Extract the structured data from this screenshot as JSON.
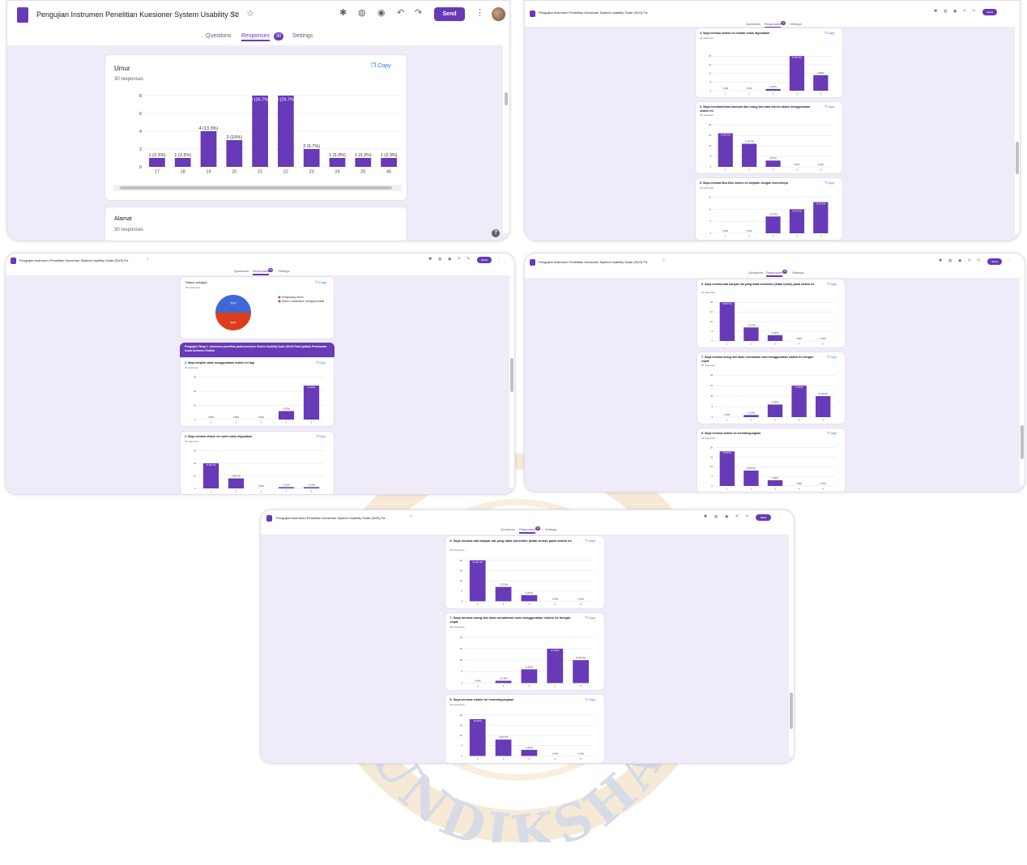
{
  "app": {
    "title": "Pengujian Instrumen Penelitian Kuesioner System Usability Sc",
    "title_small": "Pengujian Instrumen Penelitian Kuesioner System Usability Scale (SUS) Pa",
    "tabs": {
      "questions": "Questions",
      "responses": "Responses",
      "settings": "Settings"
    },
    "responses_count": "30",
    "send": "Send",
    "copy": "Copy",
    "help": "?"
  },
  "colors": {
    "accent": "#673ab7",
    "bg": "#f0ebf8",
    "blue": "#1a73e8",
    "pie_blue": "#4069d4",
    "pie_red": "#db3e1c"
  },
  "icons": [
    "forms-logo-icon",
    "folder-icon",
    "star-icon",
    "addon-icon",
    "palette-icon",
    "preview-eye-icon",
    "undo-icon",
    "redo-icon",
    "more-vert-icon",
    "copy-icon",
    "help-icon"
  ],
  "watermark": {
    "text": "UNDIKSHA"
  },
  "panel1": {
    "card_umur": {
      "title": "Umur",
      "responses": "30 responses",
      "chart_data": {
        "type": "bar",
        "categories": [
          "17",
          "18",
          "19",
          "20",
          "21",
          "22",
          "23",
          "24",
          "25",
          "45"
        ],
        "values": [
          1,
          1,
          4,
          3,
          8,
          8,
          2,
          1,
          1,
          1
        ],
        "labels": [
          "1 (3.3%)",
          "1 (3.3%)",
          "4 (13.3%)",
          "3 (10%)",
          "8 (26.7%)",
          "8 (26.7%)",
          "2 (6.7%)",
          "1 (3.3%)",
          "1 (3.3%)",
          "1 (3.3%)"
        ],
        "yticks": [
          "0",
          "2",
          "4",
          "6",
          "8"
        ],
        "ylim": [
          0,
          8
        ]
      }
    },
    "card_alamat": {
      "title": "Alamat",
      "responses": "30 responses"
    }
  },
  "panel2": {
    "cards": [
      {
        "title": "3. Saya merasa sistem ini mudah untuk digunakan",
        "responses": "30 responses",
        "chart_data": {
          "type": "bar",
          "categories": [
            "1",
            "2",
            "3",
            "4",
            "5"
          ],
          "values": [
            0,
            0,
            1,
            20,
            9
          ],
          "labels": [
            "0 (0%)",
            "0 (0%)",
            "1 (3.3%)",
            "20 (66.7%)",
            "9 (30%)"
          ],
          "yticks": [
            "0",
            "5",
            "10",
            "15",
            "20"
          ],
          "ylim": [
            0,
            25
          ]
        }
      },
      {
        "title": "4. Saya membutuhkan bantuan dari orang lain atau teknisi dalam menggunakan sistem ini",
        "responses": "30 responses",
        "chart_data": {
          "type": "bar",
          "categories": [
            "1",
            "2",
            "3",
            "4",
            "5"
          ],
          "values": [
            16,
            11,
            3,
            0,
            0
          ],
          "labels": [
            "16 (53.3%)",
            "11 (36.7%)",
            "3 (10%)",
            "0 (0%)",
            "0 (0%)"
          ],
          "yticks": [
            "0",
            "5",
            "10",
            "15",
            "20"
          ],
          "ylim": [
            0,
            20
          ]
        }
      },
      {
        "title": "5. Saya merasa fitur-fitur sistem ini berjalan dengan semestinya",
        "responses": "30 responses",
        "chart_data": {
          "type": "bar",
          "categories": [
            "1",
            "2",
            "3",
            "4",
            "5"
          ],
          "values": [
            0,
            0,
            7,
            10,
            13
          ],
          "labels": [
            "0 (0%)",
            "0 (0%)",
            "7 (23.3%)",
            "10 (33.3%)",
            "13 (43.3%)"
          ],
          "yticks": [
            "0",
            "5",
            "10",
            "15"
          ],
          "ylim": [
            0,
            15
          ]
        }
      }
    ]
  },
  "panel3": {
    "pie_card": {
      "title": "Status sebagai",
      "responses": "30 responses",
      "chart_data": {
        "type": "pie",
        "labels": [
          "Pengunjung umum",
          "Siswa / mahasiswa / tenaga pendidik"
        ],
        "values": [
          50,
          50
        ],
        "slice_labels": [
          "50%",
          "50%"
        ]
      }
    },
    "section": {
      "title": "Pengujian Tahap 1. Instrumen penelitian pada kuesioner Sistem Usability Scale (SUS) Pada Aplikasi Pemesanan Acara berbasis Chatbot"
    },
    "cards": [
      {
        "title": "1. Saya berpikir akan menggunakan sistem ini lagi",
        "responses": "30 responses",
        "chart_data": {
          "type": "bar",
          "categories": [
            "1",
            "2",
            "3",
            "4",
            "5"
          ],
          "values": [
            0,
            0,
            0,
            6,
            24
          ],
          "labels": [
            "0 (0%)",
            "0 (0%)",
            "0 (0%)",
            "6 (20%)",
            "24 (80%)"
          ],
          "yticks": [
            "0",
            "10",
            "20",
            "30"
          ],
          "ylim": [
            0,
            30
          ]
        }
      },
      {
        "title": "2. Saya merasa sistem ini rumit untuk digunakan",
        "responses": "30 responses",
        "chart_data": {
          "type": "bar",
          "categories": [
            "1",
            "2",
            "3",
            "4",
            "5"
          ],
          "values": [
            20,
            8,
            0,
            1,
            1
          ],
          "labels": [
            "20 (66.7%)",
            "8 (26.7%)",
            "0 (0%)",
            "1 (3.3%)",
            "1 (3.3%)"
          ],
          "yticks": [
            "0",
            "10",
            "20",
            "30"
          ],
          "ylim": [
            0,
            30
          ]
        }
      }
    ]
  },
  "panel4": {
    "cards": [
      {
        "title": "6. Saya merasa ada banyak hal yang tidak konsisten (tidak serasi) pada sistem ini",
        "responses": "30 responses",
        "chart_data": {
          "type": "bar",
          "categories": [
            "1",
            "2",
            "3",
            "4",
            "5"
          ],
          "values": [
            20,
            7,
            3,
            0,
            0
          ],
          "labels": [
            "20 (66.7%)",
            "7 (23.3%)",
            "3 (10%)",
            "0 (0%)",
            "0 (0%)"
          ],
          "yticks": [
            "0",
            "5",
            "10",
            "15",
            "20"
          ],
          "ylim": [
            0,
            20
          ]
        }
      },
      {
        "title": "7. Saya merasa orang lain akan memahami cara menggunakan sistem ini dengan cepat",
        "responses": "30 responses",
        "chart_data": {
          "type": "bar",
          "categories": [
            "1",
            "2",
            "3",
            "4",
            "5"
          ],
          "values": [
            0,
            1,
            6,
            15,
            10
          ],
          "labels": [
            "0 (0%)",
            "1 (3.3%)",
            "6 (20%)",
            "15 (50%)",
            "10 (33.3%)"
          ],
          "yticks": [
            "0",
            "5",
            "10",
            "15",
            "20"
          ],
          "ylim": [
            0,
            20
          ]
        }
      },
      {
        "title": "8. Saya merasa sistem ini membingungkan",
        "responses": "30 responses",
        "chart_data": {
          "type": "bar",
          "categories": [
            "1",
            "2",
            "3",
            "4",
            "5"
          ],
          "values": [
            18,
            8,
            3,
            0,
            0
          ],
          "labels": [
            "18 (60%)",
            "8 (26.7%)",
            "3 (10%)",
            "0 (0%)",
            "0 (0%)"
          ],
          "yticks": [
            "0",
            "5",
            "10",
            "15",
            "20"
          ],
          "ylim": [
            0,
            20
          ]
        }
      }
    ]
  },
  "panel5": {
    "cards": [
      {
        "title": "6. Saya merasa ada banyak hal yang tidak konsisten (tidak serasi) pada sistem ini",
        "responses": "30 responses",
        "chart_data": {
          "type": "bar",
          "categories": [
            "1",
            "2",
            "3",
            "4",
            "5"
          ],
          "values": [
            20,
            7,
            3,
            0,
            0
          ],
          "labels": [
            "20 (66.7%)",
            "7 (23.3%)",
            "3 (10%)",
            "0 (0%)",
            "0 (0%)"
          ],
          "yticks": [
            "0",
            "5",
            "10",
            "15",
            "20"
          ],
          "ylim": [
            0,
            20
          ]
        }
      },
      {
        "title": "7. Saya merasa orang lain akan memahami cara menggunakan sistem ini dengan cepat",
        "responses": "30 responses",
        "chart_data": {
          "type": "bar",
          "categories": [
            "1",
            "2",
            "3",
            "4",
            "5"
          ],
          "values": [
            0,
            1,
            6,
            15,
            10
          ],
          "labels": [
            "0 (0%)",
            "1 (3.3%)",
            "6 (20%)",
            "15 (50%)",
            "10 (33.3%)"
          ],
          "yticks": [
            "0",
            "5",
            "10",
            "15",
            "20"
          ],
          "ylim": [
            0,
            20
          ]
        }
      },
      {
        "title": "8. Saya merasa sistem ini membingungkan",
        "responses": "30 responses",
        "chart_data": {
          "type": "bar",
          "categories": [
            "1",
            "2",
            "3",
            "4",
            "5"
          ],
          "values": [
            18,
            8,
            3,
            0,
            0
          ],
          "labels": [
            "18 (60%)",
            "8 (26.7%)",
            "3 (10%)",
            "0 (0%)",
            "0 (0%)"
          ],
          "yticks": [
            "0",
            "5",
            "10",
            "15",
            "20"
          ],
          "ylim": [
            0,
            20
          ]
        }
      }
    ]
  }
}
